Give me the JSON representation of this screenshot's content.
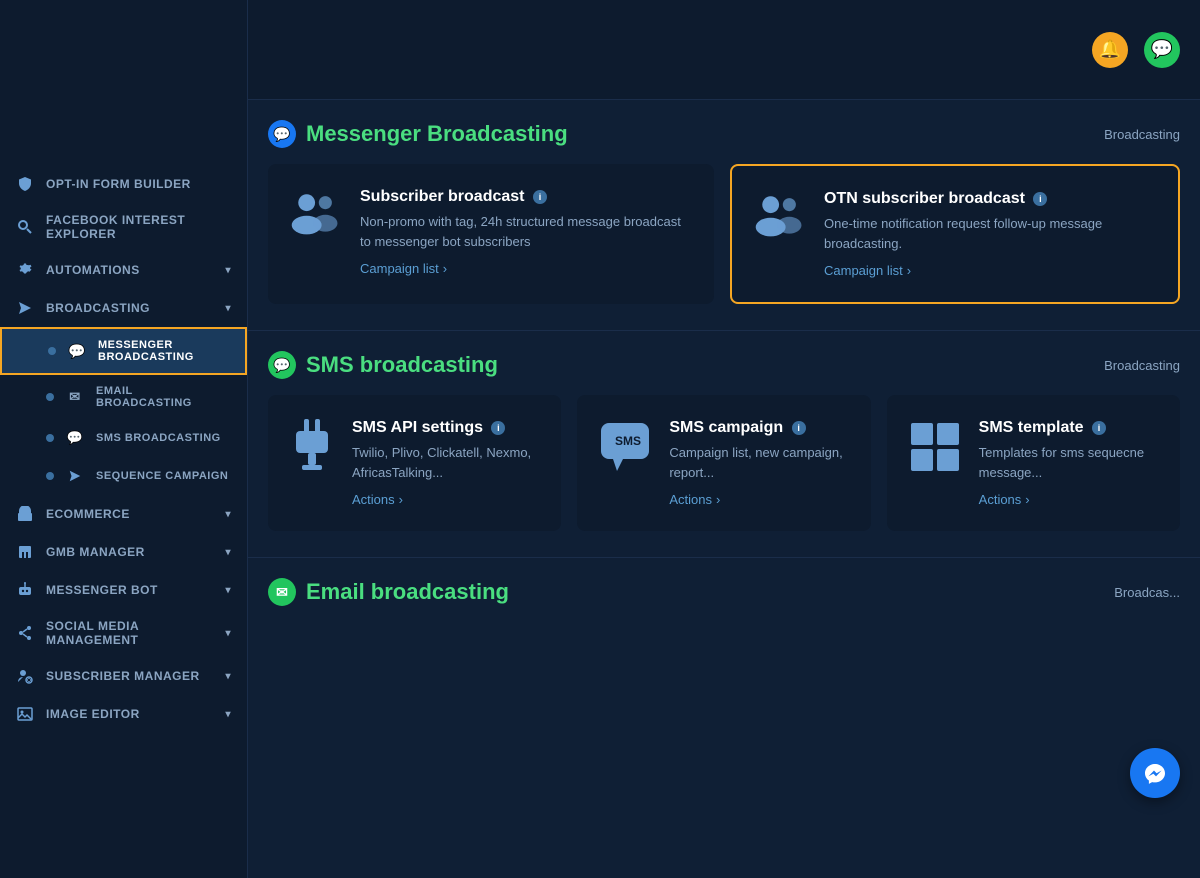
{
  "sidebar": {
    "items": [
      {
        "id": "opt-in-form",
        "label": "Opt-In Form Builder",
        "icon": "shield",
        "hasArrow": false,
        "active": false,
        "isSub": false
      },
      {
        "id": "facebook-interest",
        "label": "Facebook Interest Explorer",
        "icon": "search",
        "hasArrow": false,
        "active": false,
        "isSub": false
      },
      {
        "id": "automations",
        "label": "Automations",
        "icon": "gear",
        "hasArrow": true,
        "active": false,
        "isSub": false
      },
      {
        "id": "broadcasting",
        "label": "Broadcasting",
        "icon": "paper-plane",
        "hasArrow": true,
        "active": false,
        "isSub": false
      },
      {
        "id": "messenger-broadcasting",
        "label": "Messenger Broadcasting",
        "icon": "messenger",
        "hasArrow": false,
        "active": true,
        "isSub": true
      },
      {
        "id": "email-broadcasting",
        "label": "Email Broadcasting",
        "icon": "email",
        "hasArrow": false,
        "active": false,
        "isSub": true
      },
      {
        "id": "sms-broadcasting",
        "label": "SMS Broadcasting",
        "icon": "sms",
        "hasArrow": false,
        "active": false,
        "isSub": true
      },
      {
        "id": "sequence-campaign",
        "label": "Sequence Campaign",
        "icon": "send",
        "hasArrow": false,
        "active": false,
        "isSub": true
      },
      {
        "id": "ecommerce",
        "label": "Ecommerce",
        "icon": "store",
        "hasArrow": true,
        "active": false,
        "isSub": false
      },
      {
        "id": "gmb-manager",
        "label": "GMB Manager",
        "icon": "building",
        "hasArrow": true,
        "active": false,
        "isSub": false
      },
      {
        "id": "messenger-bot",
        "label": "Messenger Bot",
        "icon": "robot",
        "hasArrow": true,
        "active": false,
        "isSub": false
      },
      {
        "id": "social-media",
        "label": "Social Media Management",
        "icon": "share",
        "hasArrow": true,
        "active": false,
        "isSub": false
      },
      {
        "id": "subscriber-manager",
        "label": "Subscriber Manager",
        "icon": "user-cog",
        "hasArrow": true,
        "active": false,
        "isSub": false
      },
      {
        "id": "image-editor",
        "label": "Image Editor",
        "icon": "image",
        "hasArrow": true,
        "active": false,
        "isSub": false
      }
    ]
  },
  "messenger_section": {
    "title": "Messenger Broadcasting",
    "breadcrumb": "Broadcasting",
    "cards": [
      {
        "id": "subscriber-broadcast",
        "title": "Subscriber broadcast",
        "desc": "Non-promo with tag, 24h structured message broadcast to messenger bot subscribers",
        "link_text": "Campaign list",
        "highlighted": false,
        "has_info": true
      },
      {
        "id": "otn-subscriber-broadcast",
        "title": "OTN subscriber broadcast",
        "desc": "One-time notification request follow-up message broadcasting.",
        "link_text": "Campaign list",
        "highlighted": true,
        "has_info": true
      }
    ]
  },
  "sms_section": {
    "title": "SMS broadcasting",
    "breadcrumb": "Broadcasting",
    "cards": [
      {
        "id": "sms-api-settings",
        "title": "SMS API settings",
        "desc": "Twilio, Plivo, Clickatell, Nexmo, AfricasTalking...",
        "link_text": "Actions",
        "has_info": true
      },
      {
        "id": "sms-campaign",
        "title": "SMS campaign",
        "desc": "Campaign list, new campaign, report...",
        "link_text": "Actions",
        "has_info": true
      },
      {
        "id": "sms-template",
        "title": "SMS template",
        "desc": "Templates for sms sequecne message...",
        "link_text": "Actions",
        "has_info": true
      }
    ]
  },
  "email_section": {
    "title": "Email broadcasting",
    "breadcrumb": "Broadcas..."
  },
  "icons": {
    "messenger": "💬",
    "sms": "💬",
    "email": "✉",
    "info": "i",
    "arrow_right": "›",
    "chevron_down": "▾"
  }
}
